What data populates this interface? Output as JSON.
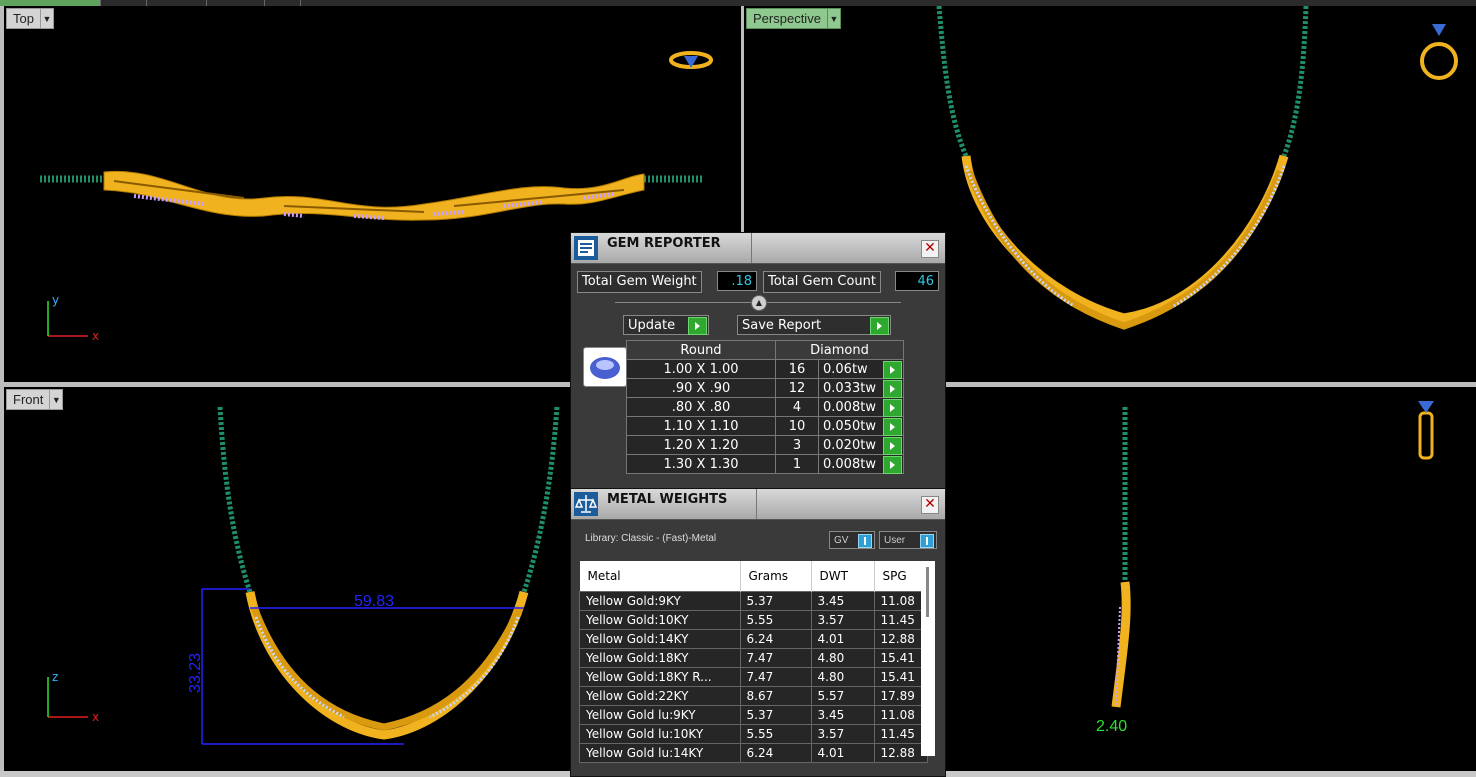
{
  "viewports": {
    "top": {
      "label": "Top",
      "axis_v": "y",
      "axis_h": "x"
    },
    "perspective": {
      "label": "Perspective"
    },
    "front": {
      "label": "Front",
      "axis_v": "z",
      "axis_h": "x",
      "dim_width": "59.83",
      "dim_height": "33.23"
    },
    "right": {
      "label_value": "2.40"
    }
  },
  "gem_reporter": {
    "title": "GEM REPORTER",
    "total_weight_label": "Total Gem Weight",
    "total_weight_value": ".18",
    "total_count_label": "Total Gem Count",
    "total_count_value": "46",
    "update_label": "Update",
    "save_label": "Save Report",
    "shape_header": "Round",
    "material_header": "Diamond",
    "rows": [
      {
        "size": "1.00 X 1.00",
        "count": "16",
        "tw": "0.06tw"
      },
      {
        "size": ".90 X .90",
        "count": "12",
        "tw": "0.033tw"
      },
      {
        "size": ".80 X .80",
        "count": "4",
        "tw": "0.008tw"
      },
      {
        "size": "1.10 X 1.10",
        "count": "10",
        "tw": "0.050tw"
      },
      {
        "size": "1.20 X 1.20",
        "count": "3",
        "tw": "0.020tw"
      },
      {
        "size": "1.30 X 1.30",
        "count": "1",
        "tw": "0.008tw"
      }
    ]
  },
  "metal_weights": {
    "title": "METAL WEIGHTS",
    "library": "Library: Classic - (Fast)-Metal",
    "toggle_gv": "GV",
    "toggle_user": "User",
    "columns": [
      "Metal",
      "Grams",
      "DWT",
      "SPG"
    ],
    "rows": [
      [
        "Yellow Gold:9KY",
        "5.37",
        "3.45",
        "11.08"
      ],
      [
        "Yellow Gold:10KY",
        "5.55",
        "3.57",
        "11.45"
      ],
      [
        "Yellow Gold:14KY",
        "6.24",
        "4.01",
        "12.88"
      ],
      [
        "Yellow Gold:18KY",
        "7.47",
        "4.80",
        "15.41"
      ],
      [
        "Yellow Gold:18KY R...",
        "7.47",
        "4.80",
        "15.41"
      ],
      [
        "Yellow Gold:22KY",
        "8.67",
        "5.57",
        "17.89"
      ],
      [
        "Yellow Gold lu:9KY",
        "5.37",
        "3.45",
        "11.08"
      ],
      [
        "Yellow Gold lu:10KY",
        "5.55",
        "3.57",
        "11.45"
      ],
      [
        "Yellow Gold lu:14KY",
        "6.24",
        "4.01",
        "12.88"
      ]
    ]
  },
  "colors": {
    "gold": "#f0b21e",
    "chain": "#1f8f6a",
    "gem": "#c9a0ff",
    "dimension": "#2222ff",
    "value_text": "#2fc6e0"
  }
}
